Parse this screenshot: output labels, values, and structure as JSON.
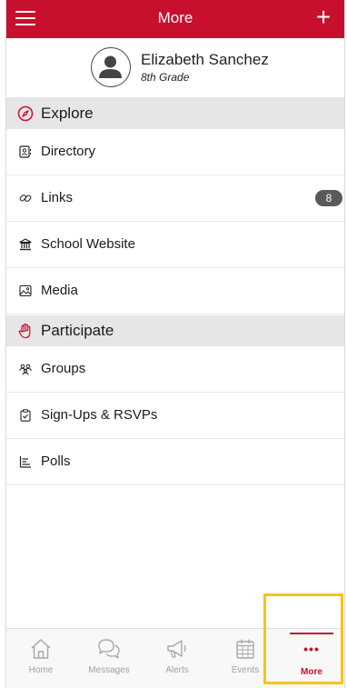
{
  "header": {
    "title": "More",
    "plus_label": "+"
  },
  "profile": {
    "name": "Elizabeth Sanchez",
    "grade": "8th Grade"
  },
  "sections": {
    "explore": {
      "label": "Explore",
      "items": {
        "directory": {
          "label": "Directory"
        },
        "links": {
          "label": "Links",
          "badge": "8"
        },
        "school_website": {
          "label": "School Website"
        },
        "media": {
          "label": "Media"
        }
      }
    },
    "participate": {
      "label": "Participate",
      "items": {
        "groups": {
          "label": "Groups"
        },
        "signups": {
          "label": "Sign-Ups & RSVPs"
        },
        "polls": {
          "label": "Polls"
        }
      }
    }
  },
  "tabbar": {
    "home": "Home",
    "messages": "Messages",
    "alerts": "Alerts",
    "events": "Events",
    "more": "More",
    "more_dots": "•••"
  },
  "colors": {
    "brand_red": "#c8102e",
    "section_bg": "#e6e6e8",
    "badge_bg": "#5a5a5a",
    "highlight": "#f5c518"
  }
}
